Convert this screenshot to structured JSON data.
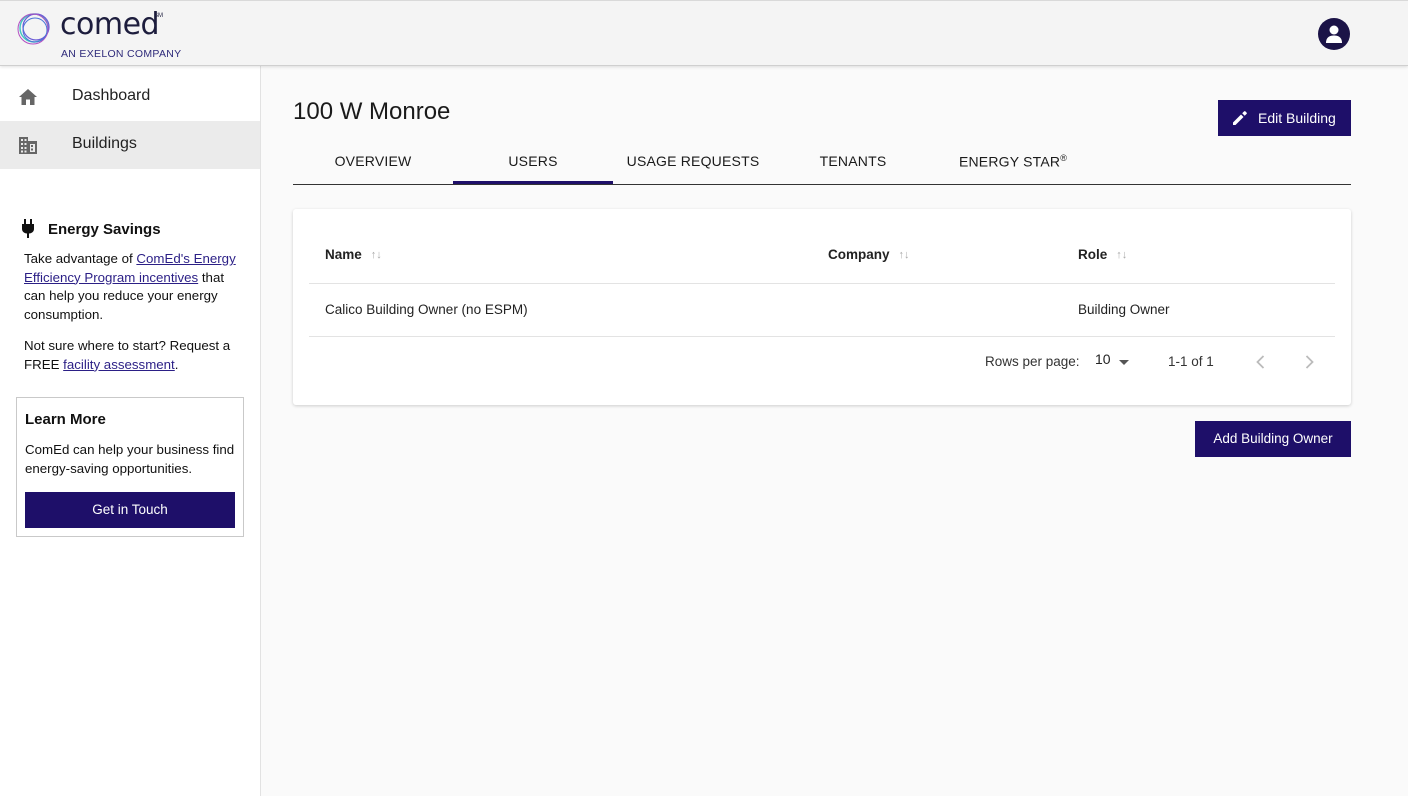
{
  "header": {
    "logo_text": "comed",
    "logo_mark": "SM",
    "logo_subtitle": "AN EXELON COMPANY",
    "avatar_icon": "account-circle-icon"
  },
  "sidebar": {
    "items": [
      {
        "label": "Dashboard",
        "icon": "home-icon",
        "active": false
      },
      {
        "label": "Buildings",
        "icon": "building-icon",
        "active": true
      }
    ],
    "savings": {
      "icon": "plug-icon",
      "title": "Energy Savings",
      "text_before": "Take advantage of ",
      "link": "ComEd's Energy Efficiency Program incentives",
      "text_after": " that can help you reduce your energy consumption.",
      "assess_before": "Not sure where to start? Request a FREE ",
      "assess_link": "facility assessment",
      "assess_after": "."
    },
    "learn_more": {
      "title": "Learn More",
      "text": "ComEd can help your business find energy-saving opportunities.",
      "button": "Get in Touch"
    }
  },
  "main": {
    "title": "100 W Monroe",
    "edit_button": "Edit Building",
    "tabs": [
      {
        "label": "OVERVIEW",
        "active": false
      },
      {
        "label": "USERS",
        "active": true
      },
      {
        "label": "USAGE REQUESTS",
        "active": false
      },
      {
        "label": "TENANTS",
        "active": false
      },
      {
        "label": "ENERGY STAR",
        "sup": "®",
        "active": false
      }
    ],
    "table": {
      "columns": [
        "Name",
        "Company",
        "Role"
      ],
      "rows": [
        {
          "name": "Calico Building Owner (no ESPM)",
          "company": "",
          "role": "Building Owner"
        }
      ]
    },
    "pagination": {
      "rows_label": "Rows per page:",
      "rows_value": "10",
      "range": "1-1 of 1"
    },
    "add_button": "Add Building Owner"
  },
  "colors": {
    "brand": "#1e0f69",
    "header_bg": "#f4f4f4",
    "active_nav": "#ebebeb"
  }
}
